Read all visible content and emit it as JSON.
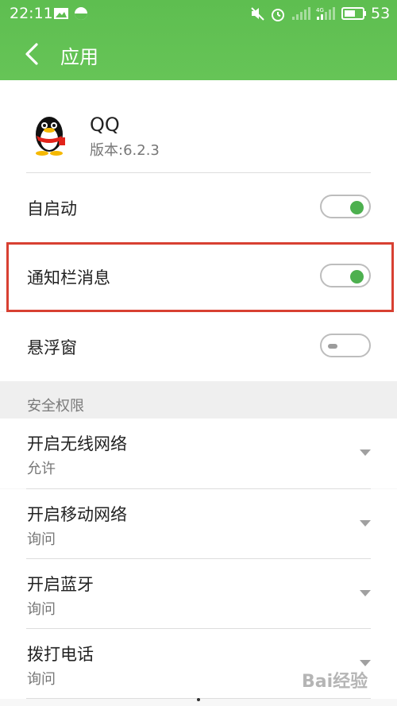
{
  "status_bar": {
    "time": "22:11",
    "battery": "53",
    "icons": [
      "image-icon",
      "circle-half-icon",
      "mute-icon",
      "alarm-icon",
      "signal-icon",
      "4g-signal-icon",
      "battery-icon"
    ]
  },
  "header": {
    "back_icon": "back-arrow-icon",
    "title": "应用"
  },
  "app": {
    "name": "QQ",
    "version": "版本:6.2.3"
  },
  "toggles": [
    {
      "label": "自启动",
      "on": true
    },
    {
      "label": "通知栏消息",
      "on": true,
      "highlighted": true
    },
    {
      "label": "悬浮窗",
      "on": false
    }
  ],
  "section": {
    "title": "安全权限"
  },
  "permissions": [
    {
      "title": "开启无线网络",
      "value": "允许"
    },
    {
      "title": "开启移动网络",
      "value": "询问"
    },
    {
      "title": "开启蓝牙",
      "value": "询问"
    },
    {
      "title": "拨打电话",
      "value": "询问"
    }
  ],
  "watermark": "Bai经验",
  "colors": {
    "header_green": "#5ebe50",
    "switch_on": "#4db04f",
    "highlight_red": "#d84032"
  }
}
